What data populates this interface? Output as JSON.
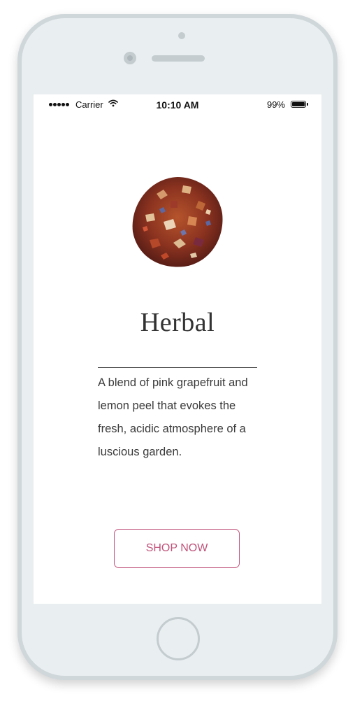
{
  "status_bar": {
    "carrier": "Carrier",
    "time": "10:10 AM",
    "battery_percent": "99%",
    "signal_bars": 5,
    "wifi_icon": "wifi-icon",
    "battery_icon": "battery-icon"
  },
  "product": {
    "image_icon": "herbal-tea-leaves-image",
    "title": "Herbal",
    "description": "A blend of pink grapefruit and lemon peel that evokes the fresh, acidic atmosphere of a luscious garden.",
    "cta_label": "SHOP NOW"
  },
  "colors": {
    "accent": "#c0537a",
    "text": "#333333",
    "device_body": "#e9eef1",
    "device_border": "#cfd7da"
  }
}
